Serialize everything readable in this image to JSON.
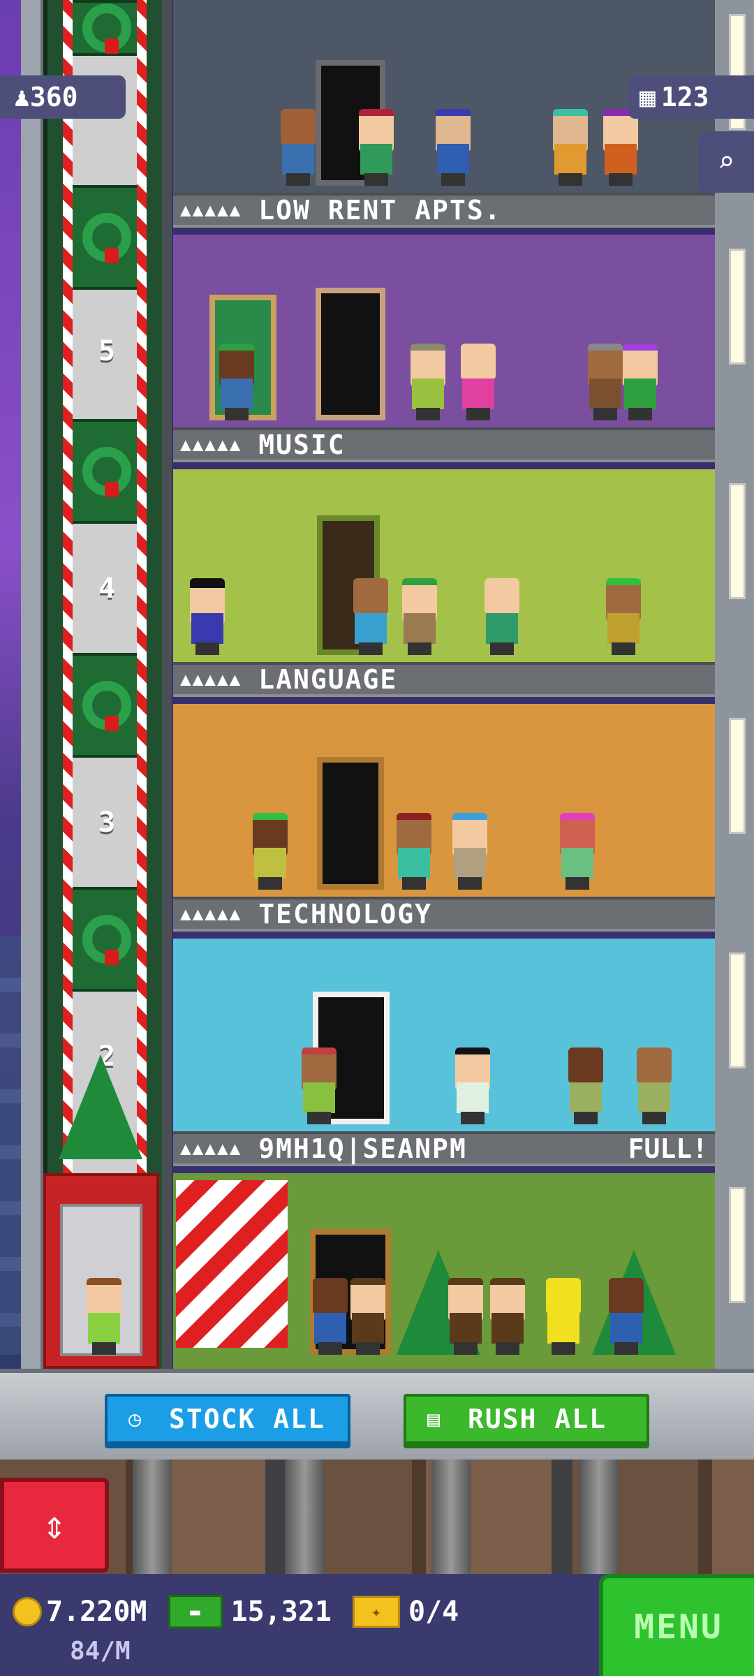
{
  "hud_top": {
    "population": "360",
    "population_icon": "person-icon",
    "floors": "123",
    "floors_icon": "building-icon",
    "search_icon": "magnifier-icon"
  },
  "elevator": {
    "floor_numbers": [
      "5",
      "4",
      "3",
      "2"
    ]
  },
  "floors": [
    {
      "stars": "▲▲▲▲▲",
      "name": "LOW RENT APTS.",
      "status": "",
      "color": "#4d5765"
    },
    {
      "stars": "▲▲▲▲▲",
      "name": "MUSIC",
      "status": "",
      "color": "#7a4fa0"
    },
    {
      "stars": "▲▲▲▲▲",
      "name": "LANGUAGE",
      "status": "",
      "color": "#a4c14a"
    },
    {
      "stars": "▲▲▲▲▲",
      "name": "TECHNOLOGY",
      "status": "",
      "color": "#d9963e"
    },
    {
      "stars": "▲▲▲▲▲",
      "name": "9MH1Q|SEANPM",
      "status": "FULL!",
      "color": "#58c2db"
    }
  ],
  "actions": {
    "stock_all": "STOCK ALL",
    "stock_icon": "clock-icon",
    "rush_all": "RUSH ALL",
    "rush_icon": "money-icon"
  },
  "hud_bottom": {
    "coins": "7.220M",
    "coin_rate": "84/M",
    "bux": "15,321",
    "tickets": "0/4",
    "menu": "MENU",
    "elevator_button_icon": "up-down-arrows-icon"
  },
  "colors": {
    "stock_button": "#1b9ee6",
    "rush_button": "#3cb82c",
    "menu_button": "#2fc22f",
    "hud_background": "#3b3a6e",
    "elevator_button": "#e8283c"
  }
}
